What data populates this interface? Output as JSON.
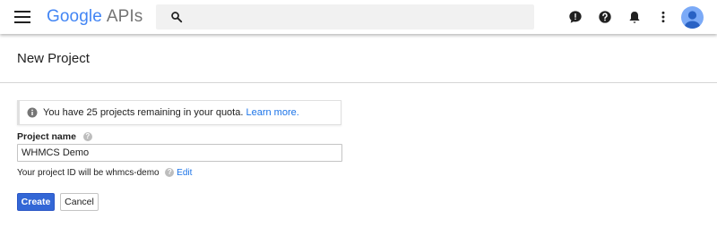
{
  "topbar": {
    "logo_google": "Google",
    "logo_apis": "APIs",
    "search": {
      "placeholder": "",
      "value": ""
    },
    "icons": [
      "menu-icon",
      "search-icon",
      "feedback-icon",
      "help-icon",
      "notifications-icon",
      "more-vert-icon",
      "account-avatar"
    ]
  },
  "page": {
    "title": "New Project"
  },
  "quota_notice": {
    "text": "You have 25 projects remaining in your quota.",
    "link": "Learn more."
  },
  "form": {
    "project_name_label": "Project name",
    "project_name_value": "WHMCS Demo",
    "project_id_text": "Your project ID will be whmcs-demo",
    "edit_link": "Edit"
  },
  "actions": {
    "create_label": "Create",
    "cancel_label": "Cancel"
  },
  "colors": {
    "primary_button": "#3367d6",
    "link": "#1a73e8",
    "avatar": "#7baaf7"
  }
}
